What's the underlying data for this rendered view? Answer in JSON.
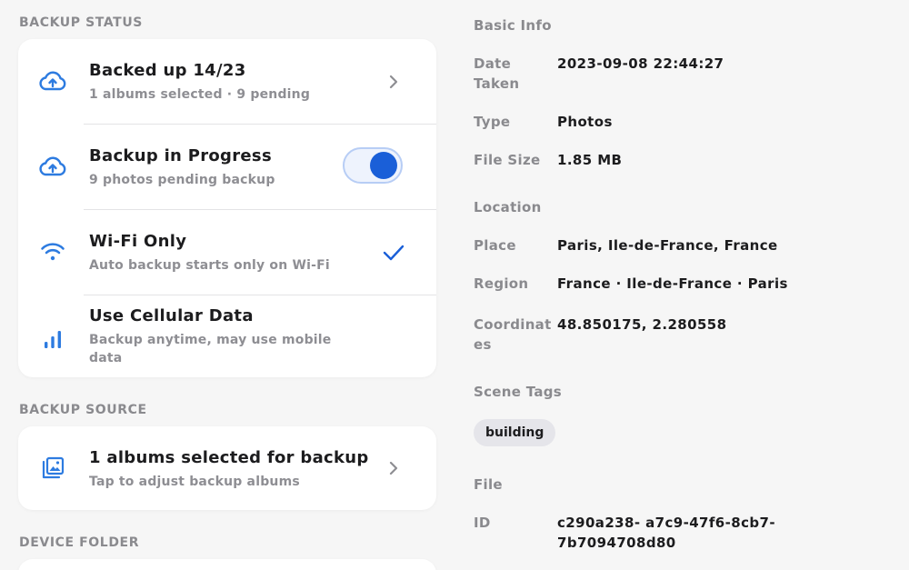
{
  "backup_status": {
    "header": "BACKUP STATUS",
    "backed_up": {
      "title": "Backed up 14/23",
      "subtitle": "1 albums selected · 9 pending"
    },
    "in_progress": {
      "title": "Backup in Progress",
      "subtitle": "9 photos pending backup",
      "toggle_on": true
    },
    "wifi_only": {
      "title": "Wi-Fi Only",
      "subtitle": "Auto backup starts only on Wi-Fi",
      "checked": true
    },
    "cellular": {
      "title": "Use Cellular Data",
      "subtitle": "Backup anytime, may use mobile data"
    }
  },
  "backup_source": {
    "header": "BACKUP SOURCE",
    "albums": {
      "title": "1 albums selected for backup",
      "subtitle": "Tap to adjust backup albums"
    }
  },
  "device_folder": {
    "header": "DEVICE FOLDER"
  },
  "info": {
    "basic_title": "Basic Info",
    "date_label": "Date Taken",
    "date_value": "2023-09-08 22:44:27",
    "type_label": "Type",
    "type_value": "Photos",
    "size_label": "File Size",
    "size_value": "1.85 MB",
    "location_title": "Location",
    "place_label": "Place",
    "place_value": "Paris, Ile-de-France, France",
    "region_label": "Region",
    "region_value": "France · Ile-de-France · Paris",
    "coords_label": "Coordinat es",
    "coords_value": "48.850175, 2.280558",
    "scene_title": "Scene Tags",
    "tag": "building",
    "file_title": "File",
    "id_label": "ID",
    "id_value": "c290a238- a7c9-47f6-8cb7-7b7094708d80"
  },
  "colors": {
    "accent": "#1a5fd8",
    "icon_blue": "#2d7be0",
    "muted": "#8a8a8e",
    "card": "#ffffff",
    "background": "#f6f6f6"
  }
}
